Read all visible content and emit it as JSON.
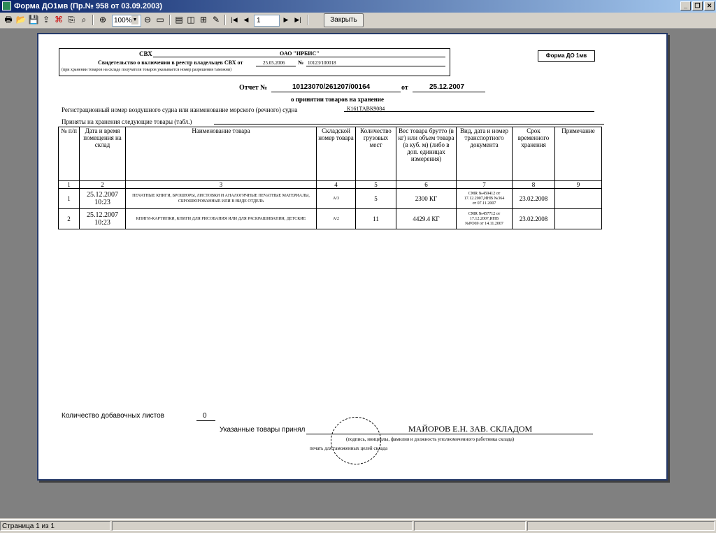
{
  "window": {
    "title": "Форма ДО1мв (Пр.№ 958 от 03.09.2003)"
  },
  "toolbar": {
    "zoom": "100%",
    "page_number": "1",
    "close_label": "Закрыть"
  },
  "document": {
    "svh_label": "СВХ",
    "svh_value": "ОАО \"ИРБИС\"",
    "certificate_label": "Свидетельство о включении в реестр владельцев СВХ от",
    "certificate_date": "25.05.2006",
    "certificate_no_label": "№",
    "certificate_no": "10123/100018",
    "storage_note": "(при хранении товаров на складе получателя товаров указывается номер разрешения таможни)",
    "form_label": "Форма ДО 1мв",
    "report_label": "Отчет №",
    "report_number": "10123070/261207/00164",
    "report_from": "от",
    "report_date": "25.12.2007",
    "report_subtitle": "о принятии товаров на хранение",
    "vessel_label": "Регистрационный номер воздушного судна или наименование морского (речного) судна",
    "vessel_value": "К161ТАВК9084",
    "accepted_label": "Приняты на хранения следующие товары (табл.)",
    "table": {
      "headers": [
        "№ п/п",
        "Дата и время помещения на склад",
        "Наименование товара",
        "Складской номер товара",
        "Количество грузовых мест",
        "Вес товара брутто (в кг) или объем товара (в куб. м) (либо в доп. единицах измерения)",
        "Вид, дата и номер транспортного документа",
        "Срок временного хранения",
        "Примечание"
      ],
      "column_numbers": [
        "1",
        "2",
        "3",
        "4",
        "5",
        "6",
        "7",
        "8",
        "9"
      ],
      "rows": [
        {
          "n": "1",
          "date": "25.12.2007",
          "time": "10:23",
          "name": "ПЕЧАТНЫЕ КНИГИ, БРОШЮРЫ, ЛИСТОВКИ И АНАЛОГИЧНЫЕ ПЕЧАТНЫЕ МАТЕРИАЛЫ, СБРОШЮРОВАННЫЕ ИЛИ В ВИДЕ ОТДЕЛЬ",
          "store": "А/3",
          "places": "5",
          "weight": "2300 КГ",
          "doc_line1": "CMR №459412 от",
          "doc_line2": "17.12.2007,ИНВ №364",
          "doc_line3": "от 07.11.2007",
          "term": "23.02.2008",
          "note": ""
        },
        {
          "n": "2",
          "date": "25.12.2007",
          "time": "10:23",
          "name": "КНИГИ-КАРТИНКИ, КНИГИ ДЛЯ РИСОВАНИЯ ИЛИ ДЛЯ РАСКРАШИВАНИЯ, ДЕТСКИЕ",
          "store": "А/2",
          "places": "11",
          "weight": "4429.4 КГ",
          "doc_line1": "CMR №457712 от",
          "doc_line2": "17.12.2007,ИНВ",
          "doc_line3": "№РО69 от 14.11.2007",
          "term": "23.02.2008",
          "note": ""
        }
      ]
    },
    "extra_sheets_label": "Количество добавочных листов",
    "extra_sheets_value": "0",
    "accepted_by_label": "Указанные товары принял",
    "accepted_by_value": "МАЙОРОВ Е.Н.   ЗАВ. СКЛАДОМ",
    "signature_note": "(подпись, инициалы, фамилия и должность уполномоченного работника склада)",
    "stamp_note": "печать для таможенных целей склада"
  },
  "status": {
    "page_info": "Страница 1 из 1"
  },
  "colors": {
    "title_gradient_start": "#0a246a",
    "title_gradient_end": "#a6caf0",
    "page_border": "#253a6a",
    "workspace": "#808080",
    "chrome": "#d4d0c8"
  }
}
